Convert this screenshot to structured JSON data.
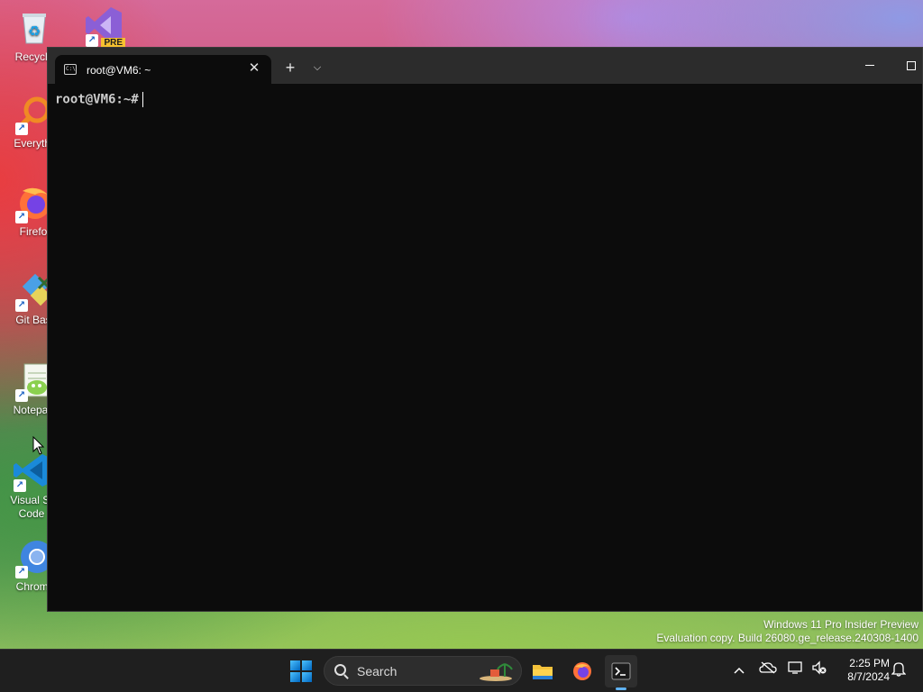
{
  "desktop": {
    "icons": [
      {
        "label": "Recycle",
        "icon": "recycle-bin-icon"
      },
      {
        "label": "Everythi",
        "icon": "everything-search-icon"
      },
      {
        "label": "Firefo",
        "icon": "firefox-icon"
      },
      {
        "label": "Git Bas",
        "icon": "git-bash-icon"
      },
      {
        "label": "Notepac",
        "icon": "notepad-plus-plus-icon"
      },
      {
        "label": "Visual St",
        "label2": "Code",
        "icon": "vscode-icon"
      },
      {
        "label": "Chromi",
        "icon": "chromium-icon"
      }
    ],
    "vs_badge": "PRE"
  },
  "terminal_window": {
    "tab_title": "root@VM6: ~",
    "prompt": "root@VM6:~#",
    "new_tab_symbol": "+",
    "dropdown_symbol": "⌵",
    "close_symbol": "✕"
  },
  "watermark": {
    "line1": "Windows 11 Pro Insider Preview",
    "line2": "Evaluation copy. Build 26080.ge_release.240308-1400"
  },
  "taskbar": {
    "search_placeholder": "Search",
    "pinned": [
      "start-icon",
      "file-explorer-icon",
      "firefox-icon",
      "terminal-icon"
    ],
    "tray_chevron": "^"
  },
  "clock": {
    "time": "2:25 PM",
    "date": "8/7/2024"
  }
}
